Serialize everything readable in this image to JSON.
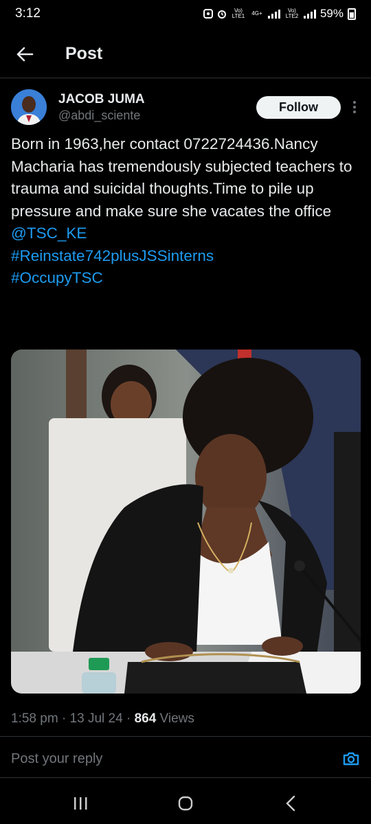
{
  "status_bar": {
    "time": "3:12",
    "sim1_label": "Vo) LTE1",
    "net_label": "4G+",
    "sim2_label": "Vo) LTE2",
    "battery": "59%"
  },
  "header": {
    "title": "Post"
  },
  "author": {
    "name": "JACOB JUMA",
    "handle": "@abdi_sciente",
    "follow_label": "Follow"
  },
  "post": {
    "text": "Born in 1963,her contact 0722724436.Nancy Macharia has tremendously subjected teachers to trauma and suicidal thoughts.Time to pile up pressure and make sure she vacates the office",
    "mention": "@TSC_KE",
    "hashtag1": "#Reinstate742plusJSSinterns",
    "hashtag2": "#OccupyTSC"
  },
  "meta": {
    "time": "1:58 pm",
    "date": "13 Jul 24",
    "views_count": "864",
    "views_label": "Views"
  },
  "reply": {
    "placeholder": "Post your reply"
  },
  "colors": {
    "accent": "#1d9bf0",
    "background": "#000000",
    "text": "#e7e9ea",
    "muted": "#71767b"
  }
}
